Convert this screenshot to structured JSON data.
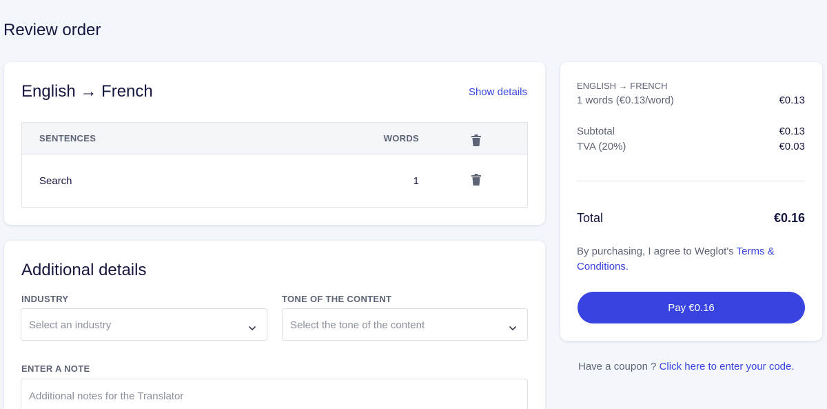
{
  "page": {
    "title": "Review order"
  },
  "language_card": {
    "title": "English → French",
    "show_details_label": "Show details",
    "table": {
      "columns": [
        "SENTENCES",
        "WORDS"
      ],
      "rows": [
        {
          "sentence": "Search",
          "words": "1"
        }
      ]
    }
  },
  "details_card": {
    "title": "Additional details",
    "industry": {
      "label": "INDUSTRY",
      "placeholder": "Select an industry"
    },
    "tone": {
      "label": "TONE OF THE CONTENT",
      "placeholder": "Select the tone of the content"
    },
    "note": {
      "label": "ENTER A NOTE",
      "placeholder": "Additional notes for the Translator"
    }
  },
  "summary": {
    "lang_pair": "ENGLISH → FRENCH",
    "words_line": {
      "label": "1 words (€0.13/word)",
      "value": "€0.13"
    },
    "subtotal": {
      "label": "Subtotal",
      "value": "€0.13"
    },
    "tva": {
      "label": "TVA (20%)",
      "value": "€0.03"
    },
    "total": {
      "label": "Total",
      "value": "€0.16"
    },
    "terms_prefix": "By purchasing, I agree to Weglot's ",
    "terms_link": "Terms & Conditions.",
    "pay_label": "Pay €0.16"
  },
  "coupon": {
    "prefix": "Have a coupon ? ",
    "link": "Click here to enter your code."
  },
  "icons": {
    "trash": "trash-icon",
    "chevron": "chevron-down-icon"
  },
  "colors": {
    "accent": "#3843e0",
    "background": "#f3f6fb",
    "text": "#15173f",
    "muted": "#5d6475"
  }
}
